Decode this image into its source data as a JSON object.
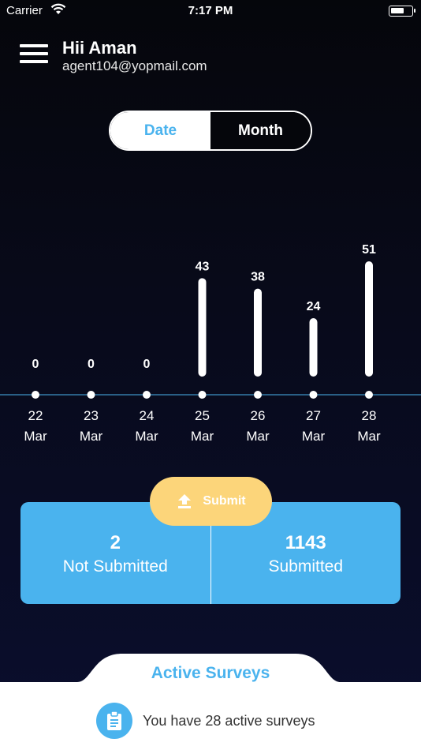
{
  "status_bar": {
    "carrier": "Carrier",
    "time": "7:17 PM"
  },
  "header": {
    "greeting": "Hii Aman",
    "email": "agent104@yopmail.com"
  },
  "toggle": {
    "date_label": "Date",
    "month_label": "Month",
    "selected": "Date"
  },
  "chart_data": {
    "type": "bar",
    "categories": [
      "22 Mar",
      "23 Mar",
      "24 Mar",
      "25 Mar",
      "26 Mar",
      "27 Mar",
      "28 Mar"
    ],
    "days": [
      "22",
      "23",
      "24",
      "25",
      "26",
      "27",
      "28"
    ],
    "months": [
      "Mar",
      "Mar",
      "Mar",
      "Mar",
      "Mar",
      "Mar",
      "Mar"
    ],
    "values": [
      0,
      0,
      0,
      43,
      38,
      24,
      51
    ],
    "title": "",
    "xlabel": "",
    "ylabel": "",
    "ylim": [
      0,
      51
    ],
    "grid": false,
    "colors": {
      "bar": "#ffffff",
      "axis": "#4ab3ee"
    }
  },
  "submit": {
    "label": "Submit"
  },
  "stats": {
    "not_submitted": {
      "value": "2",
      "label": "Not Submitted"
    },
    "submitted": {
      "value": "1143",
      "label": "Submitted"
    }
  },
  "active_surveys": {
    "title": "Active Surveys",
    "text": "You have 28 active surveys"
  },
  "colors": {
    "accent": "#4ab3ee",
    "submit": "#fcd57a",
    "background": "#05060b"
  }
}
